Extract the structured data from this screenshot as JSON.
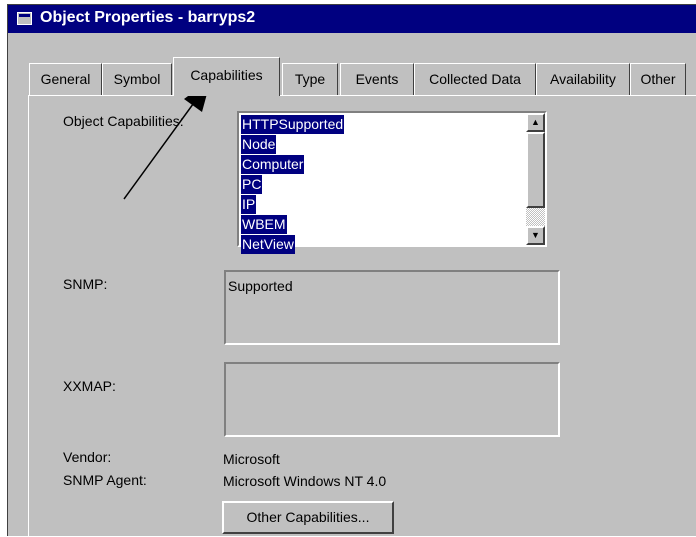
{
  "window": {
    "title": "Object Properties - barryps2"
  },
  "tabs": [
    {
      "label": "General"
    },
    {
      "label": "Symbol"
    },
    {
      "label": "Capabilities",
      "selected": true
    },
    {
      "label": "Type"
    },
    {
      "label": "Events"
    },
    {
      "label": "Collected Data"
    },
    {
      "label": "Availability"
    },
    {
      "label": "Other"
    }
  ],
  "capabilities": {
    "label": "Object Capabilities:",
    "items": [
      "HTTPSupported",
      "Node",
      "Computer",
      "PC",
      "IP",
      "WBEM",
      "NetView"
    ]
  },
  "snmp": {
    "label": "SNMP:",
    "value": "Supported"
  },
  "xxmap": {
    "label": "XXMAP:",
    "value": ""
  },
  "vendor": {
    "label": "Vendor:",
    "value": "Microsoft"
  },
  "snmp_agent": {
    "label": "SNMP Agent:",
    "value": "Microsoft Windows NT 4.0"
  },
  "buttons": {
    "other_capabilities": "Other Capabilities..."
  },
  "colors": {
    "titlebar": "#000080",
    "face": "#c0c0c0",
    "highlight": "#000080"
  },
  "icons": {
    "window": "window-icon",
    "scroll_up": "scroll-up-arrow-icon",
    "scroll_down": "scroll-down-arrow-icon",
    "callout": "callout-arrow-icon"
  }
}
